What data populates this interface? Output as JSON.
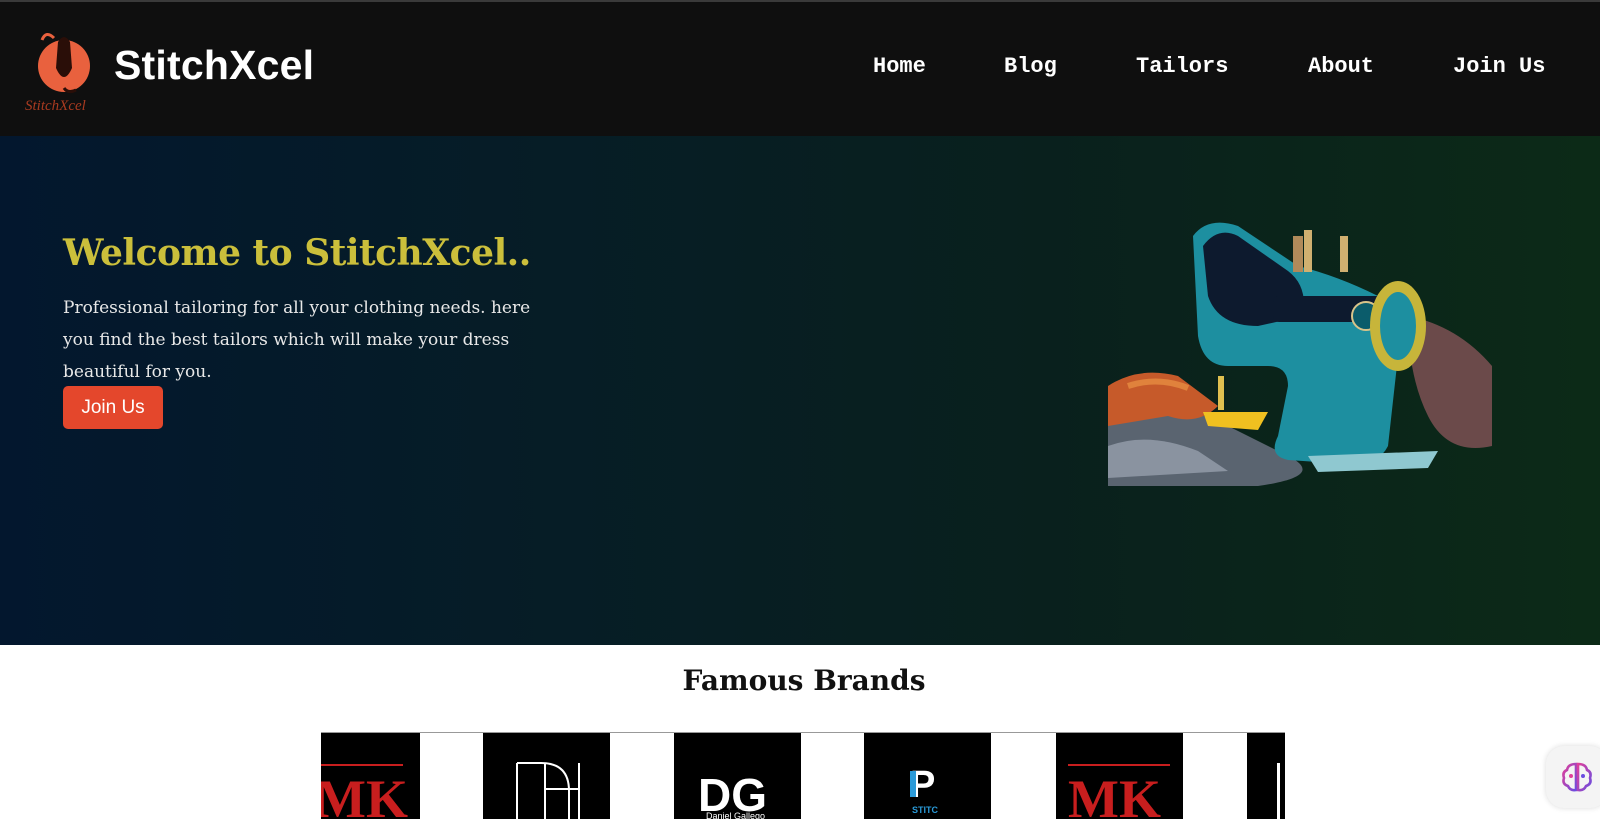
{
  "header": {
    "brand_name": "StitchXcel",
    "logo_text": "StitchXcel",
    "nav": [
      {
        "label": "Home"
      },
      {
        "label": "Blog"
      },
      {
        "label": "Tailors"
      },
      {
        "label": "About"
      },
      {
        "label": "Join Us"
      }
    ]
  },
  "hero": {
    "title": "Welcome to StitchXcel..",
    "description": "Professional tailoring for all your clothing needs. here you find the best tailors which will make your dress beautiful for you.",
    "cta_label": "Join Us",
    "image_icon": "sewing-machine"
  },
  "brands": {
    "title": "Famous Brands",
    "logos": [
      {
        "name": "MK",
        "text": "MK"
      },
      {
        "name": "DH",
        "text": "DH"
      },
      {
        "name": "DG",
        "text": "DG",
        "sub": "Daniel Gallego"
      },
      {
        "name": "P",
        "text": "P",
        "sub": "STITC"
      },
      {
        "name": "MK",
        "text": "MK"
      }
    ]
  },
  "assistant": {
    "icon": "brain-icon"
  },
  "colors": {
    "header_bg": "#0f0f0f",
    "accent": "#e4472c",
    "hero_title": "#cbbf3b"
  }
}
